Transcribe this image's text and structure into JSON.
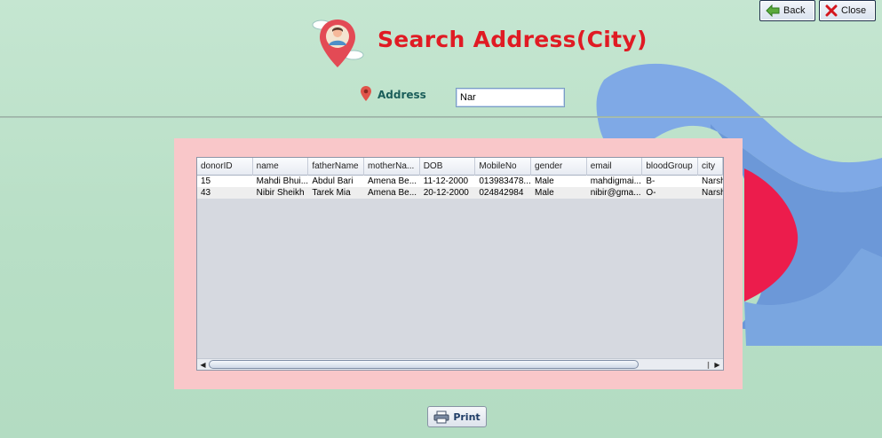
{
  "header": {
    "title": "Search Address(City)",
    "back_label": "Back",
    "close_label": "Close"
  },
  "search": {
    "label": "Address",
    "value": "Nar"
  },
  "table": {
    "columns": [
      "donorID",
      "name",
      "fatherName",
      "motherNa...",
      "DOB",
      "MobileNo",
      "gender",
      "email",
      "bloodGroup",
      "city"
    ],
    "rows": [
      [
        "15",
        "Mahdi Bhui...",
        "Abdul Bari",
        "Amena Be...",
        "11-12-2000",
        "013983478...",
        "Male",
        "mahdigmai...",
        "B-",
        "Narsh"
      ],
      [
        "43",
        "Nibir Sheikh",
        "Tarek Mia",
        "Amena Be...",
        "20-12-2000",
        "024842984",
        "Male",
        "nibir@gma...",
        "O-",
        "Narsh"
      ]
    ]
  },
  "footer": {
    "print_label": "Print"
  },
  "colors": {
    "title_red": "#e01b24",
    "panel_pink": "#f9c7c9",
    "background_green": "#bfe3cc",
    "accent_blue": "#6f9fe0",
    "accent_red": "#ec1c4c"
  },
  "icons": {
    "back": "back-arrow-icon",
    "close": "close-x-icon",
    "logo": "location-person-icon",
    "address": "map-pin-icon",
    "print": "printer-icon"
  }
}
